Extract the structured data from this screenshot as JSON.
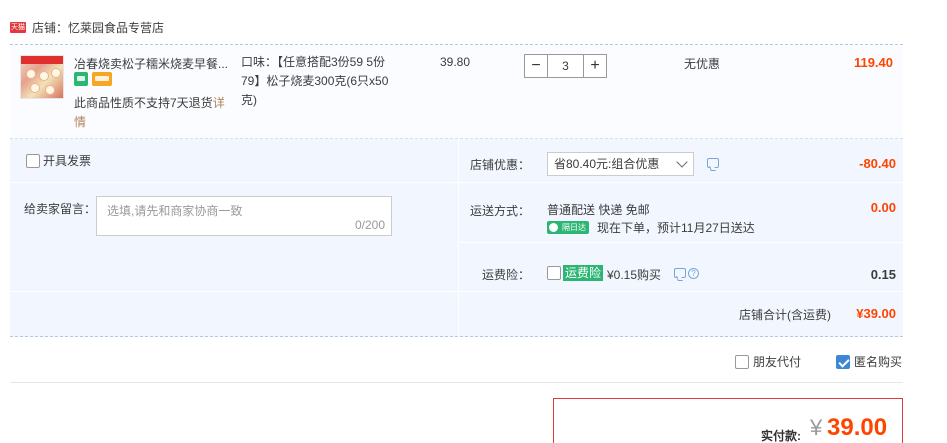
{
  "shop": {
    "badge": "天猫",
    "label": "店铺：忆莱园食品专营店"
  },
  "item": {
    "title": "冶春烧卖松子糯米烧麦早餐...",
    "return_note": "此商品性质不支持7天退货",
    "details_link": "详情",
    "sku_line1": "口味：【任意搭配3份59 5份",
    "sku_line2": "79】松子烧麦300克(6只x50",
    "sku_line3": "克)",
    "unit_price": "39.80",
    "quantity": "3",
    "minus": "−",
    "plus": "+",
    "discount_text": "无优惠",
    "subtotal": "119.40"
  },
  "options": {
    "invoice_label": "开具发票",
    "message_label": "给卖家留言：",
    "message_placeholder": "选填,请先和商家协商一致",
    "message_count": "0/200",
    "coupon_label": "店铺优惠：",
    "coupon_selected": "省80.40元:组合优惠",
    "coupon_value": "-80.40",
    "shipping_label": "运送方式：",
    "shipping_method": "普通配送 快递 免邮",
    "same_day_badge": "隔日达",
    "shipping_eta": "现在下单，预计11月27日送达",
    "shipping_value": "0.00",
    "insurance_label": "运费险：",
    "insurance_badge": "运费险",
    "insurance_text": "¥0.15购买",
    "insurance_value": "0.15",
    "total_label": "店铺合计(含运费)",
    "total_value": "¥39.00"
  },
  "purchase_options": {
    "friend_pay_label": "朋友代付",
    "friend_pay_checked": false,
    "anonymous_label": "匿名购买",
    "anonymous_checked": true
  },
  "payment": {
    "label": "实付款:",
    "currency": "¥",
    "amount": "39.00"
  },
  "colors": {
    "price_red": "#ff4400",
    "accent_blue": "#3e86d6",
    "panel_bg": "#f2f7ff",
    "green_badge": "#2bb673"
  }
}
